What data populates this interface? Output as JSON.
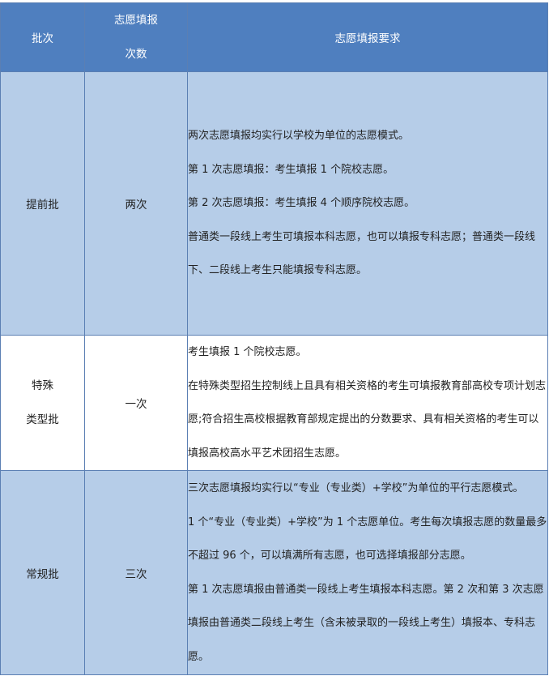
{
  "header": {
    "col_batch": "批次",
    "col_times_line1": "志愿填报",
    "col_times_line2": "次数",
    "col_requirements": "志愿填报要求"
  },
  "rows": [
    {
      "batch": "提前批",
      "times": "两次",
      "lines": [
        "两次志愿填报均实行以学校为单位的志愿模式。",
        "第 1 次志愿填报：考生填报 1 个院校志愿。",
        "第 2 次志愿填报：考生填报 4 个顺序院校志愿。",
        "普通类一段线上考生可填报本科志愿，也可以填报专科志愿；普通类一段线下、二段线上考生只能填报专科志愿。"
      ]
    },
    {
      "batch_line1": "特殊",
      "batch_line2": "类型批",
      "times": "一次",
      "lines": [
        "考生填报 1 个院校志愿。",
        "在特殊类型招生控制线上且具有相关资格的考生可填报教育部高校专项计划志愿;符合招生高校根据教育部规定提出的分数要求、具有相关资格的考生可以填报高校高水平艺术团招生志愿。"
      ]
    },
    {
      "batch": "常规批",
      "times": "三次",
      "lines": [
        "三次志愿填报均实行以“专业（专业类）+学校”为单位的平行志愿模式。",
        "1 个“专业（专业类）+学校”为 1 个志愿单位。考生每次填报志愿的数量最多不超过 96 个，可以填满所有志愿，也可选择填报部分志愿。",
        "第 1 次志愿填报由普通类一段线上考生填报本科志愿。第 2 次和第 3 次志愿填报由普通类二段线上考生（含未被录取的一段线上考生）填报本、专科志愿。"
      ]
    }
  ]
}
